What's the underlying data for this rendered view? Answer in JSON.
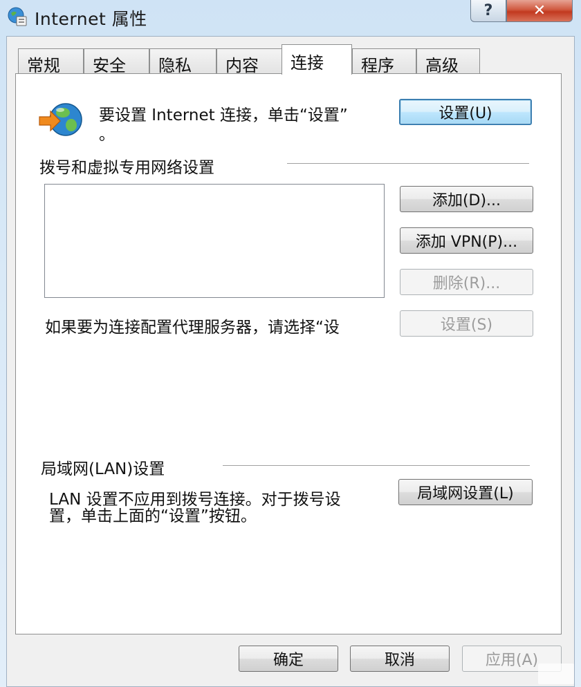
{
  "window": {
    "title": "Internet 属性",
    "help_label": "?",
    "close_label": "✕"
  },
  "tabs": [
    {
      "label": "常规",
      "active": false
    },
    {
      "label": "安全",
      "active": false
    },
    {
      "label": "隐私",
      "active": false
    },
    {
      "label": "内容",
      "active": false
    },
    {
      "label": "连接",
      "active": true
    },
    {
      "label": "程序",
      "active": false
    },
    {
      "label": "高级",
      "active": false
    }
  ],
  "setup": {
    "text_line1": "要设置 Internet 连接，单击“设置”",
    "text_line2": "。",
    "button": "设置(U)"
  },
  "dialup": {
    "heading": "拨号和虚拟专用网络设置",
    "add_button": "添加(D)...",
    "add_vpn_button": "添加 VPN(P)...",
    "delete_button": "删除(R)...",
    "proxy_text": "如果要为连接配置代理服务器，请选择“设",
    "settings_button": "设置(S)"
  },
  "lan": {
    "heading": "局域网(LAN)设置",
    "text_line1": "LAN 设置不应用到拨号连接。对于拨号设",
    "text_line2": "置，单击上面的“设置”按钮。",
    "button": "局域网设置(L)"
  },
  "footer": {
    "ok": "确定",
    "cancel": "取消",
    "apply": "应用(A)"
  },
  "colors": {
    "close_button": "#c2391f",
    "focus_border": "#3c7fb1"
  }
}
